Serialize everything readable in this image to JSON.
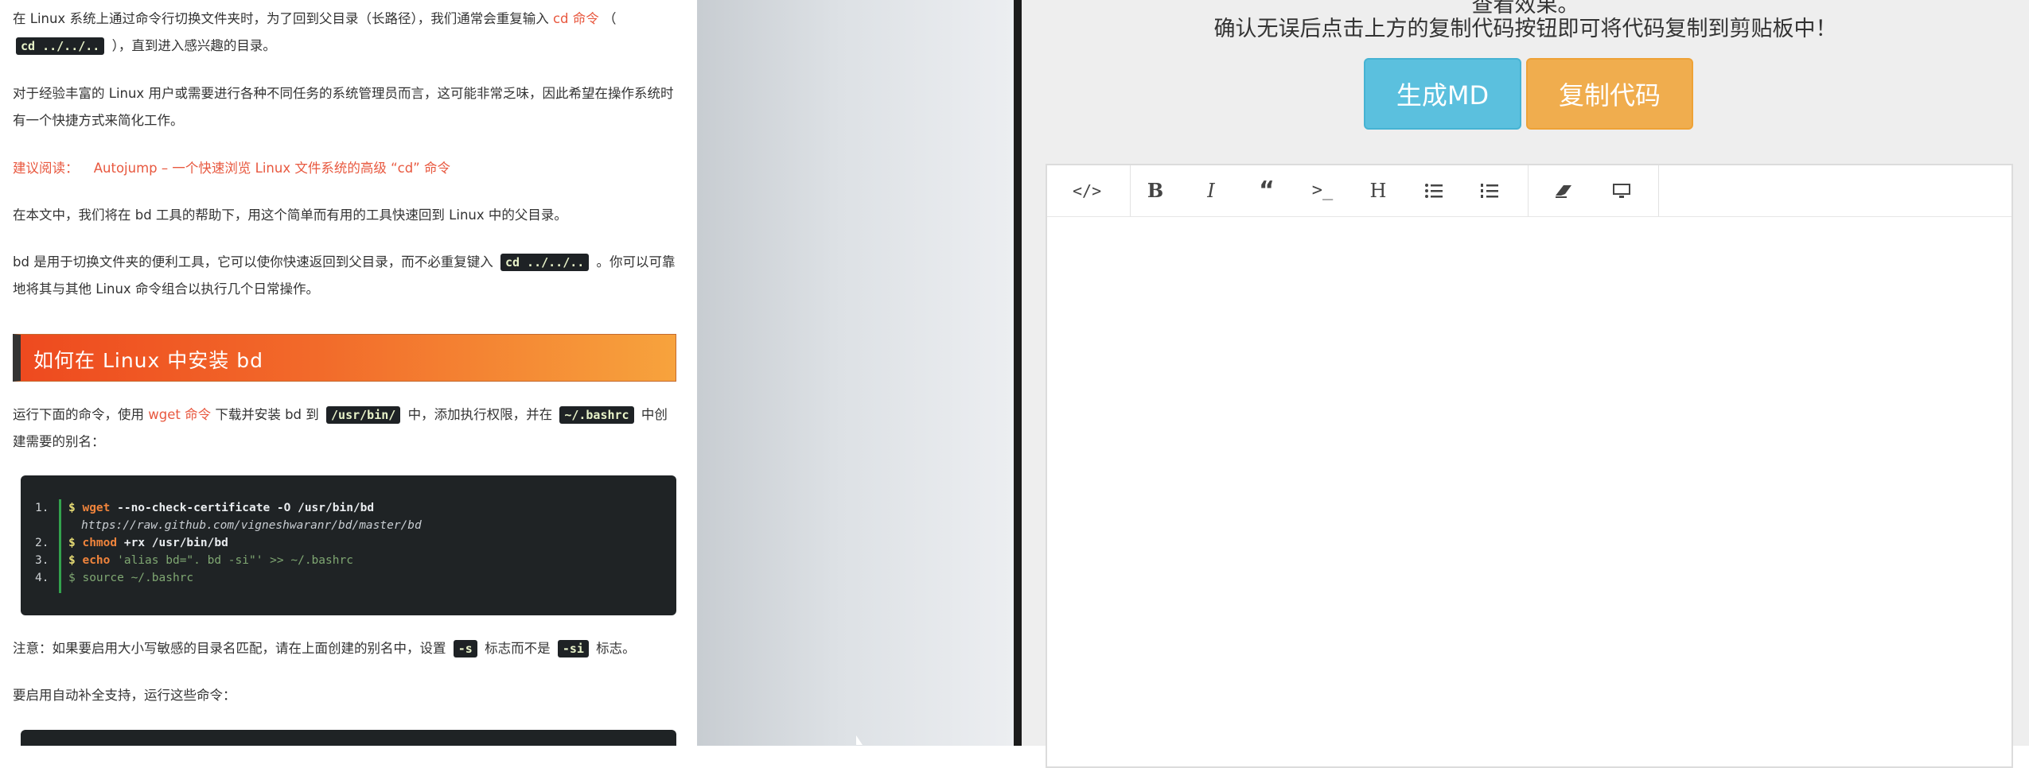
{
  "article": {
    "para1": {
      "before": "在 Linux 系统上通过命令行切换文件夹时，为了回到父目录（长路径），我们通常会重复输入",
      "link": "cd 命令",
      "mid": "（",
      "code": "cd ../../..",
      "after": "），直到进入感兴趣的目录。"
    },
    "para2": "对于经验丰富的 Linux 用户或需要进行各种不同任务的系统管理员而言，这可能非常乏味，因此希望在操作系统时有一个快捷方式来简化工作。",
    "recommend": {
      "label": "建议阅读：",
      "link": "Autojump – 一个快速浏览 Linux 文件系统的高级 “cd” 命令"
    },
    "para3": "在本文中，我们将在 bd 工具的帮助下，用这个简单而有用的工具快速回到 Linux 中的父目录。",
    "para4": {
      "before": "bd 是用于切换文件夹的便利工具，它可以使你快速返回到父目录，而不必重复键入",
      "code": "cd ../../..",
      "after": "。你可以可靠地将其与其他 Linux 命令组合以执行几个日常操作。"
    },
    "heading": "如何在 Linux 中安装 bd",
    "para5": {
      "t1": "运行下面的命令，使用",
      "link": "wget 命令",
      "t2": "下载并安装 bd 到",
      "code1": "/usr/bin/",
      "t3": "中，添加执行权限，并在",
      "code2": "~/.bashrc",
      "t4": "中创建需要的别名："
    },
    "code_lines": [
      {
        "num": "1.",
        "prompt": "$",
        "cmd": "wget",
        "rest": " --no-check-certificate -O /usr/bin/bd"
      },
      {
        "num": "",
        "url": "https://raw.github.com/vigneshwaranr/bd/master/bd"
      },
      {
        "num": "2.",
        "prompt": "$",
        "cmd": "chmod",
        "rest": " +rx /usr/bin/bd"
      },
      {
        "num": "3.",
        "prompt": "$",
        "cmd": "echo",
        "str": " 'alias bd=\". bd -si\"' >> ~/.bashrc"
      },
      {
        "num": "4.",
        "prompt": "$",
        "rest": " source ~/.bashrc"
      }
    ],
    "note": {
      "t1": "注意：如果要启用大小写敏感的目录名匹配，请在上面创建的别名中，设置",
      "code1": "-s",
      "t2": "标志而不是",
      "code2": "-si",
      "t3": "标志。"
    },
    "para6": "要启用自动补全支持，运行这些命令："
  },
  "right": {
    "heading_top": "查看效果。",
    "heading": "确认无误后点击上方的复制代码按钮即可将代码复制到剪贴板中！",
    "btn_md": "生成MD",
    "btn_copy": "复制代码",
    "toolbar": [
      "code-icon",
      "bold-icon",
      "italic-icon",
      "quote-icon",
      "terminal-icon",
      "heading-icon",
      "bullet-list-icon",
      "numbered-list-icon",
      "eraser-icon",
      "preview-icon"
    ]
  },
  "colors": {
    "accent_link": "#e8583f",
    "btn_md": "#5bc0de",
    "btn_copy": "#f0ad4e",
    "code_bg": "#1f2325"
  }
}
